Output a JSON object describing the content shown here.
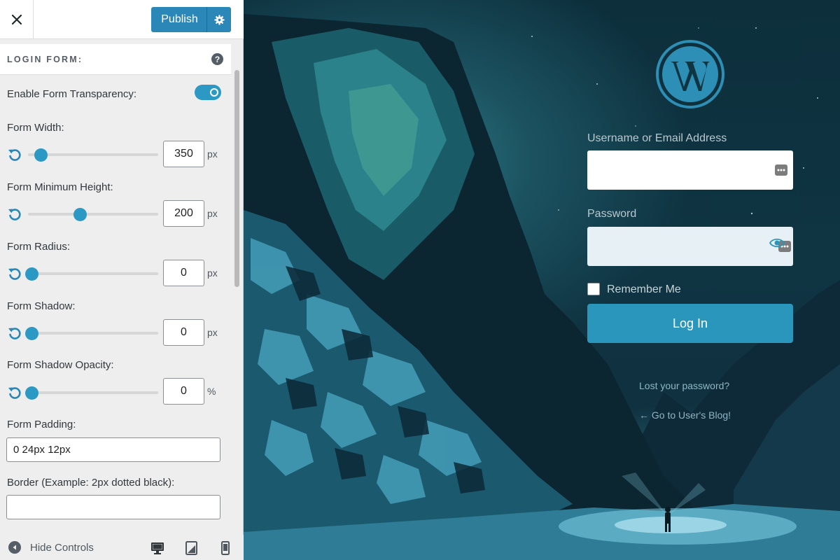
{
  "header": {
    "close_label": "Close",
    "publish_label": "Publish"
  },
  "section": {
    "title": "LOGIN FORM:",
    "help": "?"
  },
  "transparency": {
    "label": "Enable Form Transparency:",
    "enabled": true
  },
  "controls": [
    {
      "label": "Form Width:",
      "value": "350",
      "unit": "px",
      "slider_fraction": 0.1
    },
    {
      "label": "Form Minimum Height:",
      "value": "200",
      "unit": "px",
      "slider_fraction": 0.4
    },
    {
      "label": "Form Radius:",
      "value": "0",
      "unit": "px",
      "slider_fraction": 0.03
    },
    {
      "label": "Form Shadow:",
      "value": "0",
      "unit": "px",
      "slider_fraction": 0.03
    },
    {
      "label": "Form Shadow Opacity:",
      "value": "0",
      "unit": "%",
      "slider_fraction": 0.03
    }
  ],
  "padding": {
    "label": "Form Padding:",
    "value": "0 24px 12px"
  },
  "border": {
    "label": "Border (Example: 2px dotted black):",
    "value": ""
  },
  "footer": {
    "hide_label": "Hide Controls",
    "devices": [
      "desktop-icon",
      "tablet-icon",
      "mobile-icon"
    ]
  },
  "login": {
    "username_label": "Username or Email Address",
    "username_value": "",
    "password_label": "Password",
    "password_value": "",
    "remember_label": "Remember Me",
    "remember_checked": false,
    "button_label": "Log In",
    "lost_password": "Lost your password?",
    "back_link": "← Go to User's Blog!"
  },
  "colors": {
    "accent": "#2b87b8",
    "slider": "#2b99c4",
    "login_button": "#2b96bb"
  }
}
